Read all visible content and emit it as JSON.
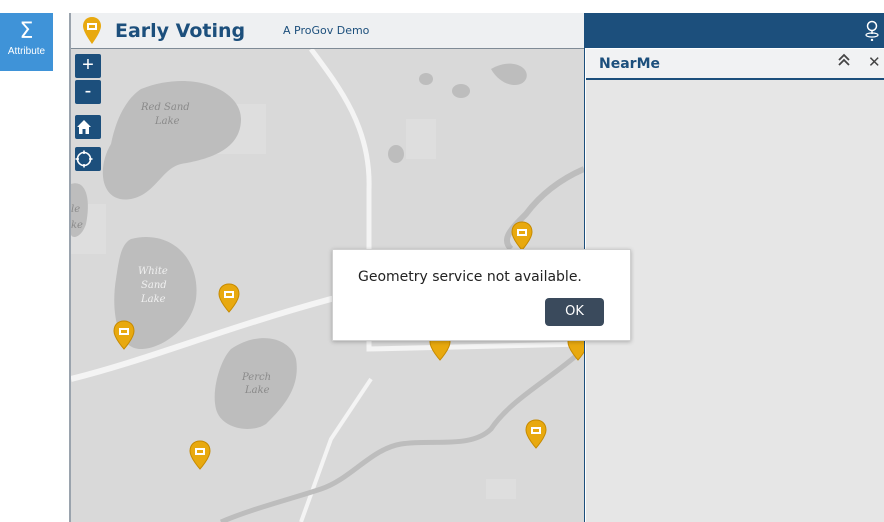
{
  "app": {
    "title": "Early Voting",
    "subtitle": "A ProGov Demo",
    "accent_color": "#1c4f7c",
    "pin_color": "#e8a90f"
  },
  "leftbar": {
    "attribute_label": "Attribute",
    "attribute_icon": "sigma-icon"
  },
  "map": {
    "zoom_in_label": "+",
    "zoom_out_label": "-",
    "home_icon": "home-icon",
    "locate_icon": "locate-icon",
    "labels": {
      "red_sand_1": "Red Sand",
      "red_sand_2": "Lake",
      "white_sand_1": "White",
      "white_sand_2": "Sand",
      "white_sand_3": "Lake",
      "perch_1": "Perch",
      "perch_2": "Lake",
      "partial_1": "le",
      "partial_2": "ke"
    },
    "marker_icon": "ballot-box-pin-icon"
  },
  "panel": {
    "title": "NearMe",
    "collapse_icon": "double-chevron-up-icon",
    "close_label": "✕",
    "header_icon": "location-pin-icon"
  },
  "dialog": {
    "message": "Geometry service not available.",
    "ok_label": "OK"
  }
}
